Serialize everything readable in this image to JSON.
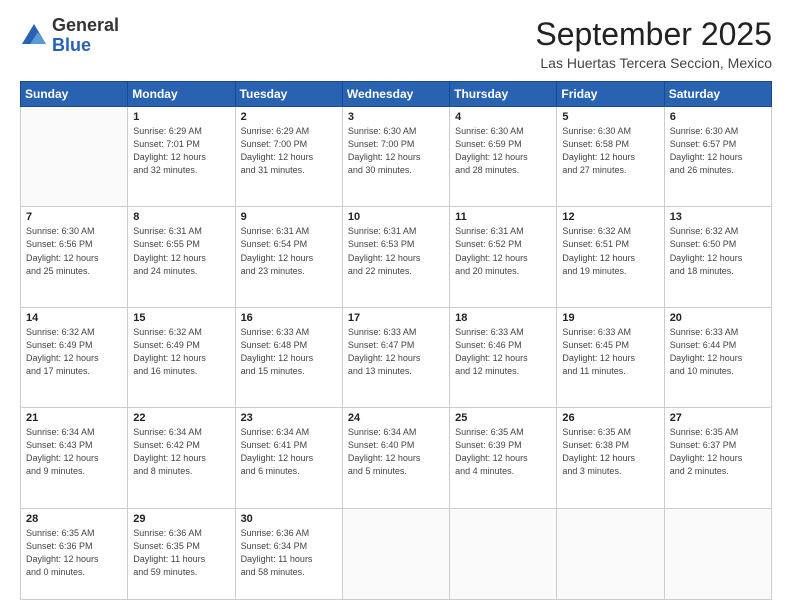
{
  "header": {
    "logo_general": "General",
    "logo_blue": "Blue",
    "month_title": "September 2025",
    "location": "Las Huertas Tercera Seccion, Mexico"
  },
  "weekdays": [
    "Sunday",
    "Monday",
    "Tuesday",
    "Wednesday",
    "Thursday",
    "Friday",
    "Saturday"
  ],
  "weeks": [
    [
      {
        "day": "",
        "info": ""
      },
      {
        "day": "1",
        "info": "Sunrise: 6:29 AM\nSunset: 7:01 PM\nDaylight: 12 hours\nand 32 minutes."
      },
      {
        "day": "2",
        "info": "Sunrise: 6:29 AM\nSunset: 7:00 PM\nDaylight: 12 hours\nand 31 minutes."
      },
      {
        "day": "3",
        "info": "Sunrise: 6:30 AM\nSunset: 7:00 PM\nDaylight: 12 hours\nand 30 minutes."
      },
      {
        "day": "4",
        "info": "Sunrise: 6:30 AM\nSunset: 6:59 PM\nDaylight: 12 hours\nand 28 minutes."
      },
      {
        "day": "5",
        "info": "Sunrise: 6:30 AM\nSunset: 6:58 PM\nDaylight: 12 hours\nand 27 minutes."
      },
      {
        "day": "6",
        "info": "Sunrise: 6:30 AM\nSunset: 6:57 PM\nDaylight: 12 hours\nand 26 minutes."
      }
    ],
    [
      {
        "day": "7",
        "info": "Sunrise: 6:30 AM\nSunset: 6:56 PM\nDaylight: 12 hours\nand 25 minutes."
      },
      {
        "day": "8",
        "info": "Sunrise: 6:31 AM\nSunset: 6:55 PM\nDaylight: 12 hours\nand 24 minutes."
      },
      {
        "day": "9",
        "info": "Sunrise: 6:31 AM\nSunset: 6:54 PM\nDaylight: 12 hours\nand 23 minutes."
      },
      {
        "day": "10",
        "info": "Sunrise: 6:31 AM\nSunset: 6:53 PM\nDaylight: 12 hours\nand 22 minutes."
      },
      {
        "day": "11",
        "info": "Sunrise: 6:31 AM\nSunset: 6:52 PM\nDaylight: 12 hours\nand 20 minutes."
      },
      {
        "day": "12",
        "info": "Sunrise: 6:32 AM\nSunset: 6:51 PM\nDaylight: 12 hours\nand 19 minutes."
      },
      {
        "day": "13",
        "info": "Sunrise: 6:32 AM\nSunset: 6:50 PM\nDaylight: 12 hours\nand 18 minutes."
      }
    ],
    [
      {
        "day": "14",
        "info": "Sunrise: 6:32 AM\nSunset: 6:49 PM\nDaylight: 12 hours\nand 17 minutes."
      },
      {
        "day": "15",
        "info": "Sunrise: 6:32 AM\nSunset: 6:49 PM\nDaylight: 12 hours\nand 16 minutes."
      },
      {
        "day": "16",
        "info": "Sunrise: 6:33 AM\nSunset: 6:48 PM\nDaylight: 12 hours\nand 15 minutes."
      },
      {
        "day": "17",
        "info": "Sunrise: 6:33 AM\nSunset: 6:47 PM\nDaylight: 12 hours\nand 13 minutes."
      },
      {
        "day": "18",
        "info": "Sunrise: 6:33 AM\nSunset: 6:46 PM\nDaylight: 12 hours\nand 12 minutes."
      },
      {
        "day": "19",
        "info": "Sunrise: 6:33 AM\nSunset: 6:45 PM\nDaylight: 12 hours\nand 11 minutes."
      },
      {
        "day": "20",
        "info": "Sunrise: 6:33 AM\nSunset: 6:44 PM\nDaylight: 12 hours\nand 10 minutes."
      }
    ],
    [
      {
        "day": "21",
        "info": "Sunrise: 6:34 AM\nSunset: 6:43 PM\nDaylight: 12 hours\nand 9 minutes."
      },
      {
        "day": "22",
        "info": "Sunrise: 6:34 AM\nSunset: 6:42 PM\nDaylight: 12 hours\nand 8 minutes."
      },
      {
        "day": "23",
        "info": "Sunrise: 6:34 AM\nSunset: 6:41 PM\nDaylight: 12 hours\nand 6 minutes."
      },
      {
        "day": "24",
        "info": "Sunrise: 6:34 AM\nSunset: 6:40 PM\nDaylight: 12 hours\nand 5 minutes."
      },
      {
        "day": "25",
        "info": "Sunrise: 6:35 AM\nSunset: 6:39 PM\nDaylight: 12 hours\nand 4 minutes."
      },
      {
        "day": "26",
        "info": "Sunrise: 6:35 AM\nSunset: 6:38 PM\nDaylight: 12 hours\nand 3 minutes."
      },
      {
        "day": "27",
        "info": "Sunrise: 6:35 AM\nSunset: 6:37 PM\nDaylight: 12 hours\nand 2 minutes."
      }
    ],
    [
      {
        "day": "28",
        "info": "Sunrise: 6:35 AM\nSunset: 6:36 PM\nDaylight: 12 hours\nand 0 minutes."
      },
      {
        "day": "29",
        "info": "Sunrise: 6:36 AM\nSunset: 6:35 PM\nDaylight: 11 hours\nand 59 minutes."
      },
      {
        "day": "30",
        "info": "Sunrise: 6:36 AM\nSunset: 6:34 PM\nDaylight: 11 hours\nand 58 minutes."
      },
      {
        "day": "",
        "info": ""
      },
      {
        "day": "",
        "info": ""
      },
      {
        "day": "",
        "info": ""
      },
      {
        "day": "",
        "info": ""
      }
    ]
  ]
}
